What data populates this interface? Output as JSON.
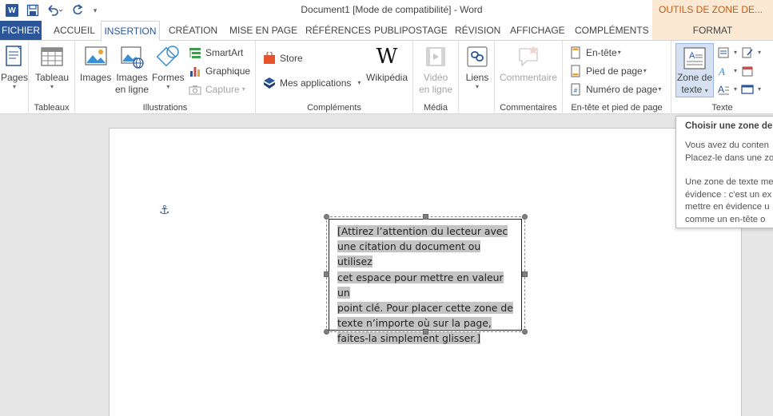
{
  "window": {
    "title": "Document1 [Mode de compatibilité] - Word",
    "context_tab_header": "OUTILS DE ZONE DE..."
  },
  "qat": {
    "app_icon": "word-icon",
    "app_letter": "W",
    "save": "save-icon",
    "undo": "undo-icon",
    "redo": "redo-icon",
    "customize": "▾"
  },
  "tabs": [
    "FICHIER",
    "ACCUEIL",
    "INSERTION",
    "CRÉATION",
    "MISE EN PAGE",
    "RÉFÉRENCES",
    "PUBLIPOSTAGE",
    "RÉVISION",
    "AFFICHAGE",
    "COMPLÉMENTS",
    "FORMAT"
  ],
  "active_tab": "INSERTION",
  "ribbon": {
    "pages": {
      "label": "Pages",
      "caret": "▾"
    },
    "tableaux": {
      "group": "Tableaux",
      "tableau": "Tableau",
      "caret": "▾"
    },
    "illustrations": {
      "group": "Illustrations",
      "images": "Images",
      "images_en_ligne_1": "Images",
      "images_en_ligne_2": "en ligne",
      "formes": "Formes",
      "formes_caret": "▾",
      "smartart": "SmartArt",
      "graphique": "Graphique",
      "capture": "Capture",
      "capture_caret": "▾"
    },
    "complements": {
      "group": "Compléments",
      "store": "Store",
      "mes_applications": "Mes applications",
      "mes_applications_caret": "▾",
      "wikipedia": "Wikipédia",
      "wikipedia_logo": "W"
    },
    "media": {
      "group": "Média",
      "video_1": "Vidéo",
      "video_2": "en ligne"
    },
    "liens": {
      "label": "Liens",
      "caret": "▾"
    },
    "commentaires": {
      "group": "Commentaires",
      "commentaire": "Commentaire"
    },
    "entete": {
      "group": "En-tête et pied de page",
      "en_tete": "En-tête",
      "pied": "Pied de page",
      "numero": "Numéro de page",
      "caret": "▾"
    },
    "texte": {
      "group": "Texte",
      "zone_1": "Zone de",
      "zone_2": "texte",
      "zone_caret": "▾",
      "small_caret": "▾"
    }
  },
  "document": {
    "textbox_text": "[Attirez l’attention du lecteur avec une citation du document ou utilisez cet espace pour mettre en valeur un point clé. Pour placer cette zone de texte n’importe où sur la page, faites-la simplement glisser.]",
    "textbox_lines": [
      "[Attirez l’attention du lecteur avec",
      "une citation du document ou utilisez",
      "cet espace pour mettre en valeur un",
      "point clé. Pour placer cette zone de",
      "texte n’importe où sur la page,",
      "faites-la simplement glisser.]"
    ],
    "anchor_icon": "⚓"
  },
  "tooltip": {
    "title": "Choisir une zone de",
    "line1": "Vous avez du conten",
    "line2": "Placez-le dans une zo",
    "line3": "Une zone de texte me",
    "line4": "évidence : c'est un ex",
    "line5": "mettre en évidence u",
    "line6": "comme un en-tête o"
  },
  "colors": {
    "accent": "#2b579a",
    "context_bg": "#fbe9d4",
    "context_fg": "#c55a11",
    "selection": "#c4c4c4"
  }
}
